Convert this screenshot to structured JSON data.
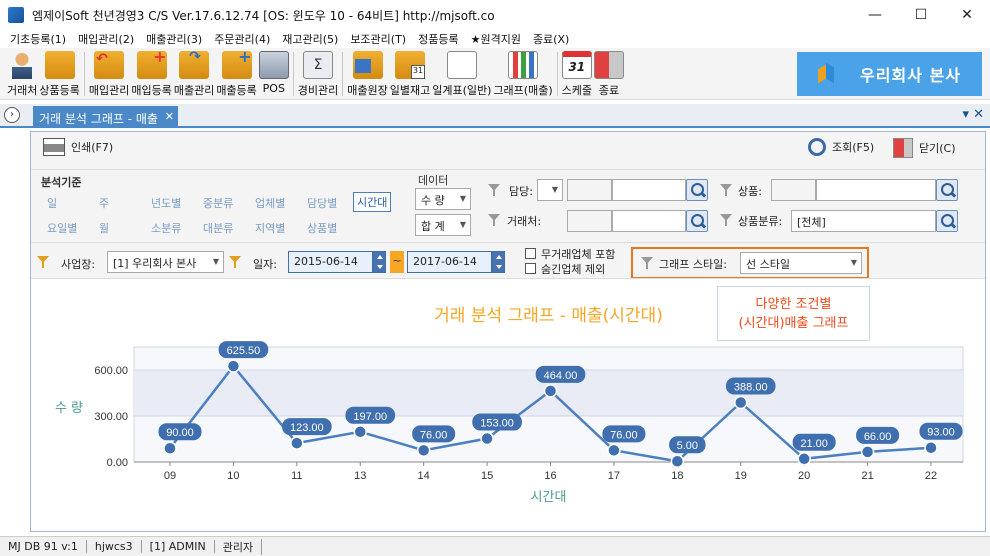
{
  "window": {
    "title": "엠제이Soft 천년경영3 C/S    Ver.17.6.12.74   [OS: 윈도우 10 - 64비트]   http://mjsoft.co",
    "min": "—",
    "max": "☐",
    "close": "✕"
  },
  "menu": [
    "기초등록(1)",
    "매입관리(2)",
    "매출관리(3)",
    "주문관리(4)",
    "재고관리(5)",
    "보조관리(T)",
    "정품등록",
    "★원격지원",
    "종료(X)"
  ],
  "toolbar": [
    {
      "label": "거래처",
      "icon": "person-icon"
    },
    {
      "label": "상품등록",
      "icon": "boxes-icon"
    },
    {
      "label": "매입관리",
      "icon": "box-in-icon"
    },
    {
      "label": "매입등록",
      "icon": "box-add-icon"
    },
    {
      "label": "매출관리",
      "icon": "box-out-icon"
    },
    {
      "label": "매출등록",
      "icon": "box-plus-icon"
    },
    {
      "label": "POS",
      "icon": "pos-icon"
    },
    {
      "label": "경비관리",
      "icon": "sum-icon"
    },
    {
      "label": "매출원장",
      "icon": "ledger-icon"
    },
    {
      "label": "일별재고",
      "icon": "calendar-box-icon"
    },
    {
      "label": "일계표(일반)",
      "icon": "document-icon"
    },
    {
      "label": "그래프(매출)",
      "icon": "bar-chart-icon"
    },
    {
      "label": "스케줄",
      "icon": "calendar-icon"
    },
    {
      "label": "종료",
      "icon": "exit-icon"
    }
  ],
  "brand": "우리회사 본사",
  "tab": {
    "label": "거래 분석 그래프 - 매출",
    "close": "✕"
  },
  "subtoolbar": {
    "print": "인쇄(F7)",
    "search": "조회(F5)",
    "close": "닫기(C)"
  },
  "filter": {
    "basis_title": "분석기준",
    "basis_row1": [
      "일",
      "주",
      "년도별",
      "중분류",
      "업체별",
      "담당별",
      "시간대"
    ],
    "basis_row2": [
      "요일별",
      "월",
      "소분류",
      "대분류",
      "지역별",
      "상품별"
    ],
    "active_basis": "시간대",
    "data_title": "데이터",
    "data_combo": "수 량",
    "total_combo": "합 계",
    "manager_label": "담당:",
    "customer_label": "거래처:",
    "product_label": "상품:",
    "category_label": "상품분류:",
    "category_value": "[전체]",
    "branch_label": "사업장:",
    "branch_value": "[1] 우리회사 본사",
    "date_label": "일자:",
    "date_from": "2015-06-14",
    "date_to": "2017-06-14",
    "tilde": "~",
    "chk1": "무거래업체 포함",
    "chk2": "숨긴업체 제외",
    "style_label": "그래프 스타일:",
    "style_value": "선 스타일"
  },
  "callout": {
    "line1": "다양한 조건별",
    "line2": "(시간대)매출 그래프"
  },
  "chart_data": {
    "type": "line",
    "title": "거래 분석 그래프 - 매출(시간대)",
    "xlabel": "시간대",
    "ylabel": "수 량",
    "categories": [
      "09",
      "10",
      "11",
      "13",
      "14",
      "15",
      "16",
      "17",
      "18",
      "19",
      "20",
      "21",
      "22"
    ],
    "values": [
      90,
      625.5,
      123,
      197,
      76,
      153,
      464,
      76,
      5,
      388,
      21,
      66,
      93
    ],
    "value_labels": [
      "90.00",
      "625.50",
      "123.00",
      "197.00",
      "76.00",
      "153.00",
      "464.00",
      "76.00",
      "5.00",
      "388.00",
      "21.00",
      "66.00",
      "93.00"
    ],
    "yticks": [
      "0.00",
      "300.00",
      "600.00"
    ],
    "ylim": [
      0,
      750
    ],
    "color": "#4a7fc0",
    "title_color": "#f5a623"
  },
  "status": [
    "MJ DB 91 v:1",
    "hjwcs3",
    "[1] ADMIN",
    "관리자"
  ]
}
